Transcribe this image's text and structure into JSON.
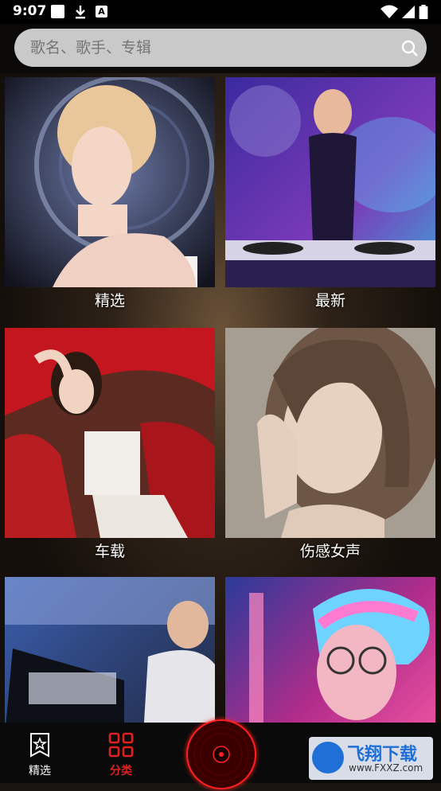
{
  "status_bar": {
    "time": "9:07"
  },
  "search": {
    "placeholder": "歌名、歌手、专辑"
  },
  "categories": [
    {
      "label": "精选"
    },
    {
      "label": "最新"
    },
    {
      "label": "车载"
    },
    {
      "label": "伤感女声"
    }
  ],
  "bottom_nav": {
    "items": [
      {
        "label": "精选",
        "icon": "star-page-icon"
      },
      {
        "label": "分类",
        "icon": "grid-icon"
      }
    ]
  },
  "watermark": {
    "title": "飞翔下载",
    "url": "www.FXXZ.com"
  },
  "colors": {
    "accent": "#e02020",
    "search_bg": "#c9c9c9"
  }
}
